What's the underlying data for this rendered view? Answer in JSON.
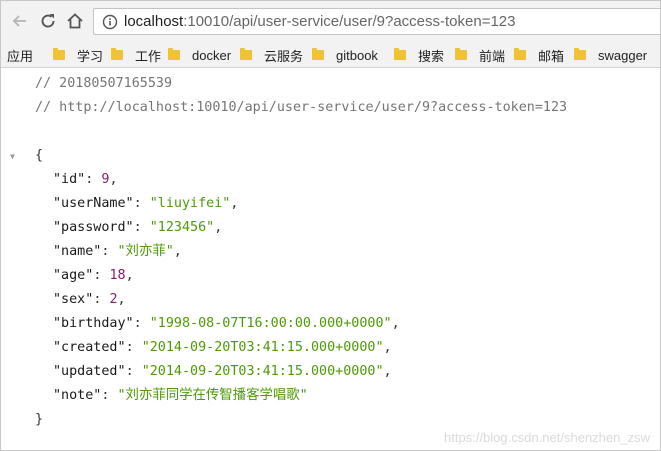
{
  "browser": {
    "url": {
      "host": "localhost",
      "path": ":10010/api/user-service/user/9?access-token=123"
    }
  },
  "bookmarks": {
    "apps_label": "应用",
    "items": [
      {
        "label": "学习",
        "icon": "folder-icon"
      },
      {
        "label": "工作",
        "icon": "folder-icon"
      },
      {
        "label": "docker",
        "icon": "folder-icon"
      },
      {
        "label": "云服务",
        "icon": "folder-icon"
      },
      {
        "label": "gitbook",
        "icon": "folder-icon"
      },
      {
        "label": "搜索",
        "icon": "folder-icon"
      },
      {
        "label": "前端",
        "icon": "folder-icon"
      },
      {
        "label": "邮箱",
        "icon": "folder-icon"
      },
      {
        "label": "swagger",
        "icon": "folder-icon"
      }
    ]
  },
  "json_view": {
    "comment_timestamp": "// 20180507165539",
    "comment_url": "// http://localhost:10010/api/user-service/user/9?access-token=123",
    "open_brace": "{",
    "close_brace": "}",
    "fields": [
      {
        "key": "\"id\"",
        "value": "9",
        "type": "num"
      },
      {
        "key": "\"userName\"",
        "value": "\"liuyifei\"",
        "type": "str"
      },
      {
        "key": "\"password\"",
        "value": "\"123456\"",
        "type": "str"
      },
      {
        "key": "\"name\"",
        "value": "\"刘亦菲\"",
        "type": "str"
      },
      {
        "key": "\"age\"",
        "value": "18",
        "type": "num"
      },
      {
        "key": "\"sex\"",
        "value": "2",
        "type": "num"
      },
      {
        "key": "\"birthday\"",
        "value": "\"1998-08-07T16:00:00.000+0000\"",
        "type": "str"
      },
      {
        "key": "\"created\"",
        "value": "\"2014-09-20T03:41:15.000+0000\"",
        "type": "str"
      },
      {
        "key": "\"updated\"",
        "value": "\"2014-09-20T03:41:15.000+0000\"",
        "type": "str"
      },
      {
        "key": "\"note\"",
        "value": "\"刘亦菲同学在传智播客学唱歌\"",
        "type": "str"
      }
    ]
  },
  "watermark": "https://blog.csdn.net/shenzhen_zsw",
  "colors": {
    "string": "#4e9a06",
    "number": "#8b1c6b",
    "comment": "#757575",
    "folder": "#f1c232"
  }
}
